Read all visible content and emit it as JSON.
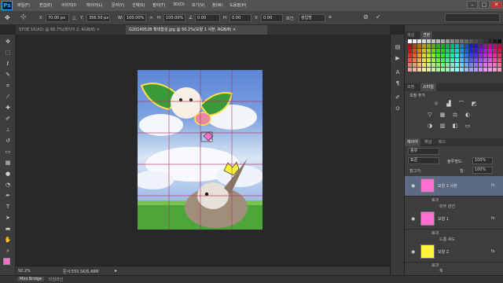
{
  "app": {
    "logo": "Ps"
  },
  "menu": [
    "파일(F)",
    "편집(E)",
    "이미지(I)",
    "레이어(L)",
    "문자(Y)",
    "선택(S)",
    "필터(T)",
    "3D(D)",
    "보기(V)",
    "창(W)",
    "도움말(H)"
  ],
  "window_controls": {
    "minimize": "–",
    "maximize": "□",
    "close": "✕"
  },
  "options": {
    "x_label": "X:",
    "x_value": "70.00 px",
    "y_label": "Y:",
    "y_value": "356.50 px",
    "w_label": "W:",
    "w_value": "100.00%",
    "h_label": "H:",
    "h_value": "100.00%",
    "angle_value": "0.00",
    "hskew_label": "H:",
    "hskew_value": "0.00",
    "vskew_label": "V:",
    "vskew_value": "0.00",
    "interp_label": "보간:",
    "interp_value": "쌍입방"
  },
  "doc_tabs": [
    {
      "label": "STOE 16(A2) @ 66.7%(레이어 2, RGB/8) ×",
      "active": false
    },
    {
      "label": "G2014052B 확대합성.jpg @ 50.2%(모양 1 사본, RGB/8) ×",
      "active": true
    }
  ],
  "status": {
    "zoom": "50.2%",
    "doc_info": "문서:555.5K/6.48M"
  },
  "bottom_tabs": [
    "Mini Bridge",
    "타임라인"
  ],
  "panels": {
    "color_tabs": [
      "색상",
      "견본"
    ],
    "adjust_tabs": [
      "조정",
      "스타일"
    ],
    "adjust_title": "조정 추가",
    "layer_tabs": [
      "레이어",
      "채널",
      "패스"
    ],
    "kind_label": "종류",
    "mode_label": "표준",
    "opacity_label": "불투명도:",
    "opacity_value": "100%",
    "lock_label": "잠그기:",
    "fill_label": "칠:",
    "fill_value": "100%"
  },
  "layers": [
    {
      "name": "모양 1 사본",
      "selected": true,
      "fx": "fx",
      "thumb_color": "#ff6fd0",
      "effects": [
        "효과",
        "외부 광선"
      ]
    },
    {
      "name": "모양 1",
      "selected": false,
      "fx": "fx",
      "thumb_color": "#ff6fd0",
      "effects": [
        "효과",
        "드롭 섀도"
      ]
    },
    {
      "name": "모양 2",
      "selected": false,
      "fx": "fx",
      "thumb_color": "#fff23a",
      "effects": [
        "효과",
        "획"
      ]
    }
  ],
  "colors": {
    "foreground": "#ff6fc8",
    "background": "#ffffff",
    "accent": "#31a8ff",
    "selection": "#5c6a84"
  }
}
